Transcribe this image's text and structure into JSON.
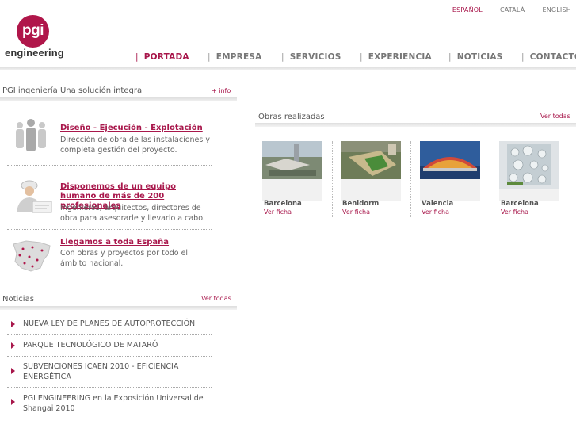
{
  "languages": [
    "ESPAÑOL",
    "CATALÀ",
    "ENGLISH"
  ],
  "logo": {
    "mark": "pgi",
    "word": "engineering"
  },
  "nav": [
    "PORTADA",
    "EMPRESA",
    "SERVICIOS",
    "EXPERIENCIA",
    "NOTICIAS",
    "CONTACTO"
  ],
  "intro": {
    "title": "PGI ingeniería Una solución integral",
    "more": "+ info"
  },
  "features": [
    {
      "title": "Diseño - Ejecución - Explotación",
      "desc": "Dirección de obra de las instalaciones y completa gestión del proyecto."
    },
    {
      "title": "Disponemos de un equipo humano de más de 200 profesionales",
      "desc": "Ingenieros, arquitectos, directores de obra para asesorarle y llevarlo a cabo."
    },
    {
      "title": "Llegamos a toda España",
      "desc": "Con obras y proyectos por todo el ámbito nacional."
    }
  ],
  "noticias": {
    "title": "Noticias",
    "more": "Ver todas",
    "items": [
      "NUEVA LEY DE PLANES DE AUTOPROTECCIÓN",
      "PARQUE TECNOLÓGICO DE MATARÓ",
      "SUBVENCIONES ICAEN 2010 - EFICIENCIA ENERGÉTICA",
      "PGI ENGINEERING en la Exposición Universal de Shangai 2010"
    ]
  },
  "obras": {
    "title": "Obras realizadas",
    "more": "Ver todas",
    "items": [
      {
        "city": "Barcelona",
        "link": "Ver ficha"
      },
      {
        "city": "Benidorm",
        "link": "Ver ficha"
      },
      {
        "city": "Valencia",
        "link": "Ver ficha"
      },
      {
        "city": "Barcelona",
        "link": "Ver ficha"
      }
    ]
  },
  "colors": {
    "accent": "#a8174b",
    "logo": "#b0164a"
  }
}
